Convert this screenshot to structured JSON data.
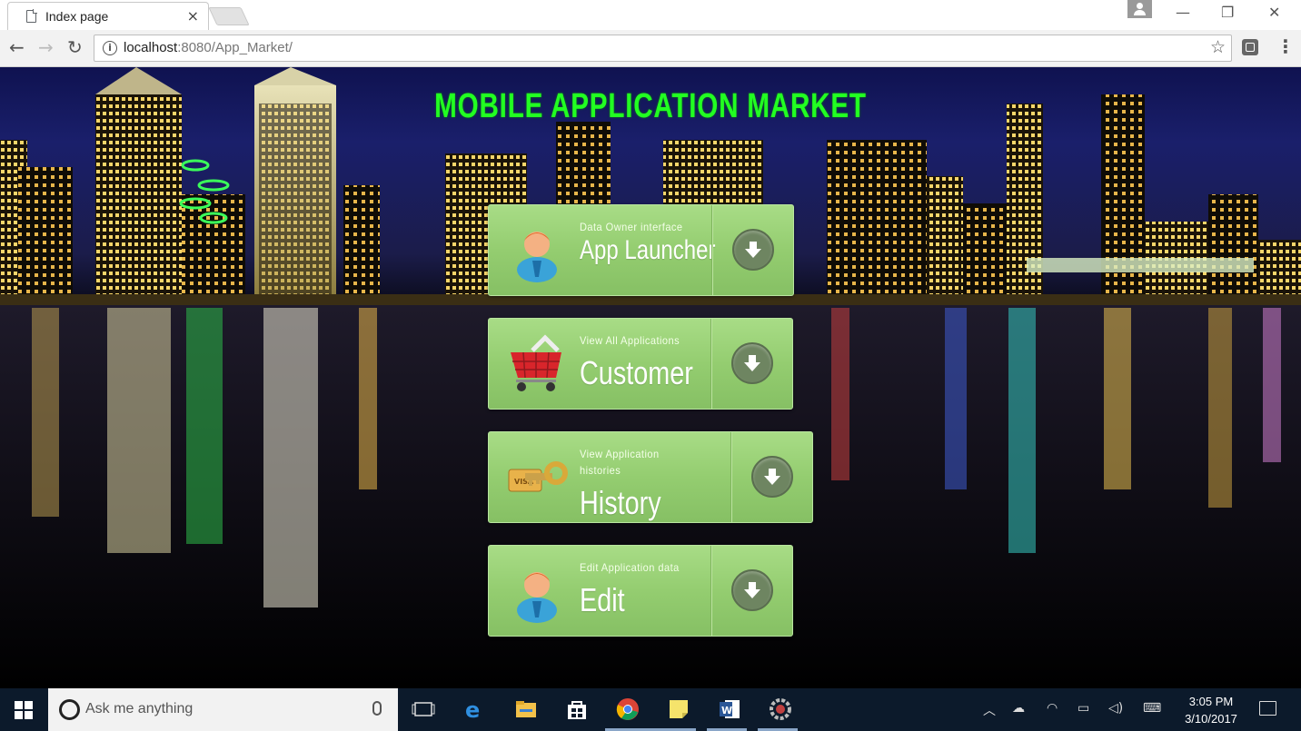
{
  "browser": {
    "tab_title": "Index page",
    "tab_close": "×",
    "url_host": "localhost",
    "url_rest": ":8080/App_Market/",
    "window_controls": {
      "minimize": "—",
      "restore": "❐",
      "close": "✕"
    }
  },
  "page": {
    "title": "MOBILE APPLICATION MARKET",
    "title_color": "#22ff22",
    "cards": [
      {
        "subtitle": "Data Owner interface",
        "label": "App Launcher",
        "icon": "user-icon",
        "action_icon": "download-arrow-icon"
      },
      {
        "subtitle": "View All Applications",
        "label": "Customer",
        "icon": "shopping-cart-icon",
        "action_icon": "download-arrow-icon"
      },
      {
        "subtitle": "View Application histories",
        "label": "History",
        "icon": "key-card-icon",
        "action_icon": "download-arrow-icon"
      },
      {
        "subtitle": "Edit Application data",
        "label": "Edit",
        "icon": "user-icon",
        "action_icon": "download-arrow-icon"
      }
    ],
    "card_color": "#94cd70"
  },
  "taskbar": {
    "search_placeholder": "Ask me anything",
    "pinned": [
      "task-view-icon",
      "edge-icon",
      "file-explorer-icon",
      "store-icon",
      "chrome-icon",
      "sticky-notes-icon",
      "word-icon",
      "settings-gear-icon"
    ],
    "time": "3:05 PM",
    "date": "3/10/2017"
  }
}
